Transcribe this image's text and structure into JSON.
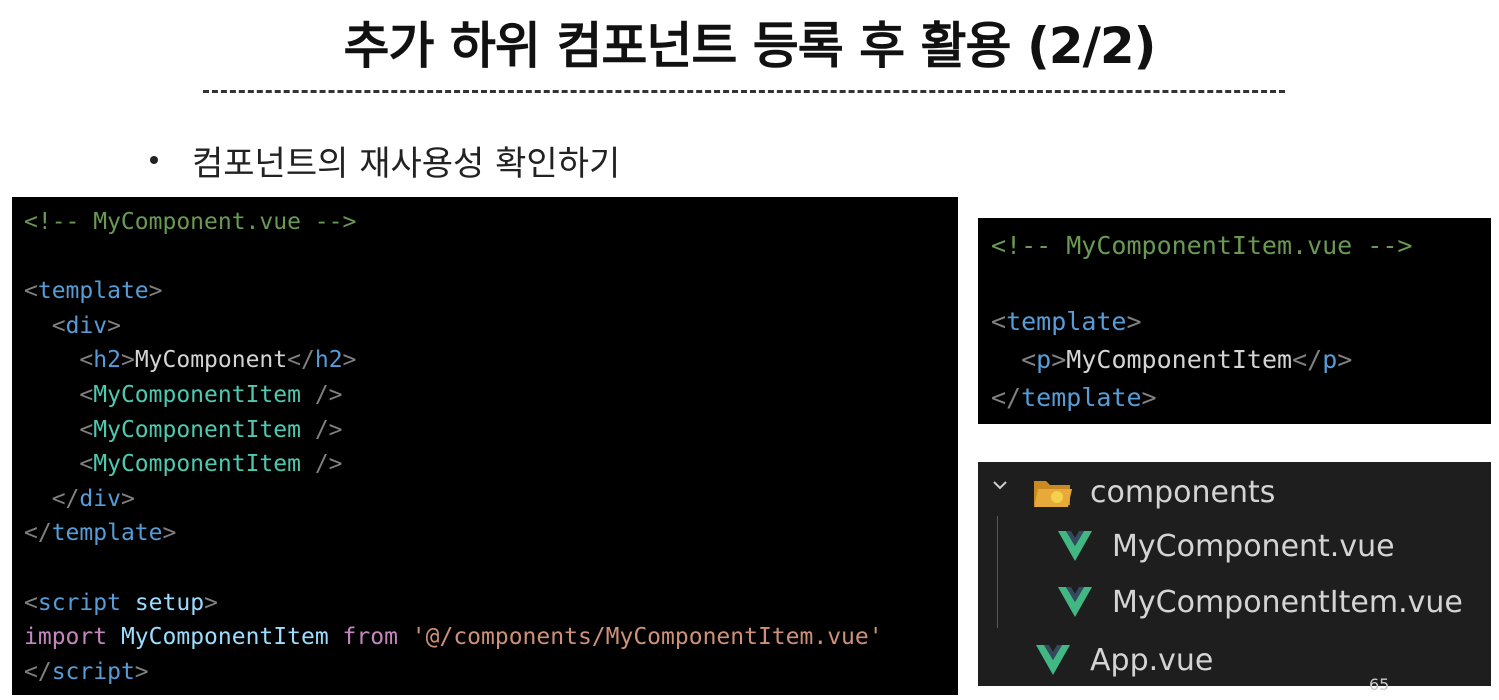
{
  "slide": {
    "title": "추가 하위 컴포넌트 등록 후 활용 (2/2)",
    "bullet": "컴포넌트의 재사용성 확인하기",
    "page_number": "65"
  },
  "code_main": {
    "filename_comment": "<!-- MyComponent.vue -->",
    "tag_template": "template",
    "tag_div": "div",
    "tag_h2": "h2",
    "h2_text": "MyComponent",
    "child_component": "MyComponentItem",
    "self_close": " />",
    "tag_script": "script",
    "attr_setup": "setup",
    "kw_import": "import",
    "import_name": "MyComponentItem",
    "kw_from": "from",
    "import_path": "'@/components/MyComponentItem.vue'"
  },
  "code_item": {
    "filename_comment": "<!-- MyComponentItem.vue -->",
    "tag_template": "template",
    "tag_p": "p",
    "p_text": "MyComponentItem"
  },
  "explorer": {
    "folder": "components",
    "files": [
      "MyComponent.vue",
      "MyComponentItem.vue",
      "App.vue"
    ],
    "icons": {
      "folder": "folder-open-icon",
      "vue": "vue-logo-icon",
      "chevron": "chevron-down-icon"
    },
    "colors": {
      "vue_light": "#41b883",
      "vue_dark": "#35495e",
      "folder": "#e8a93b"
    }
  }
}
